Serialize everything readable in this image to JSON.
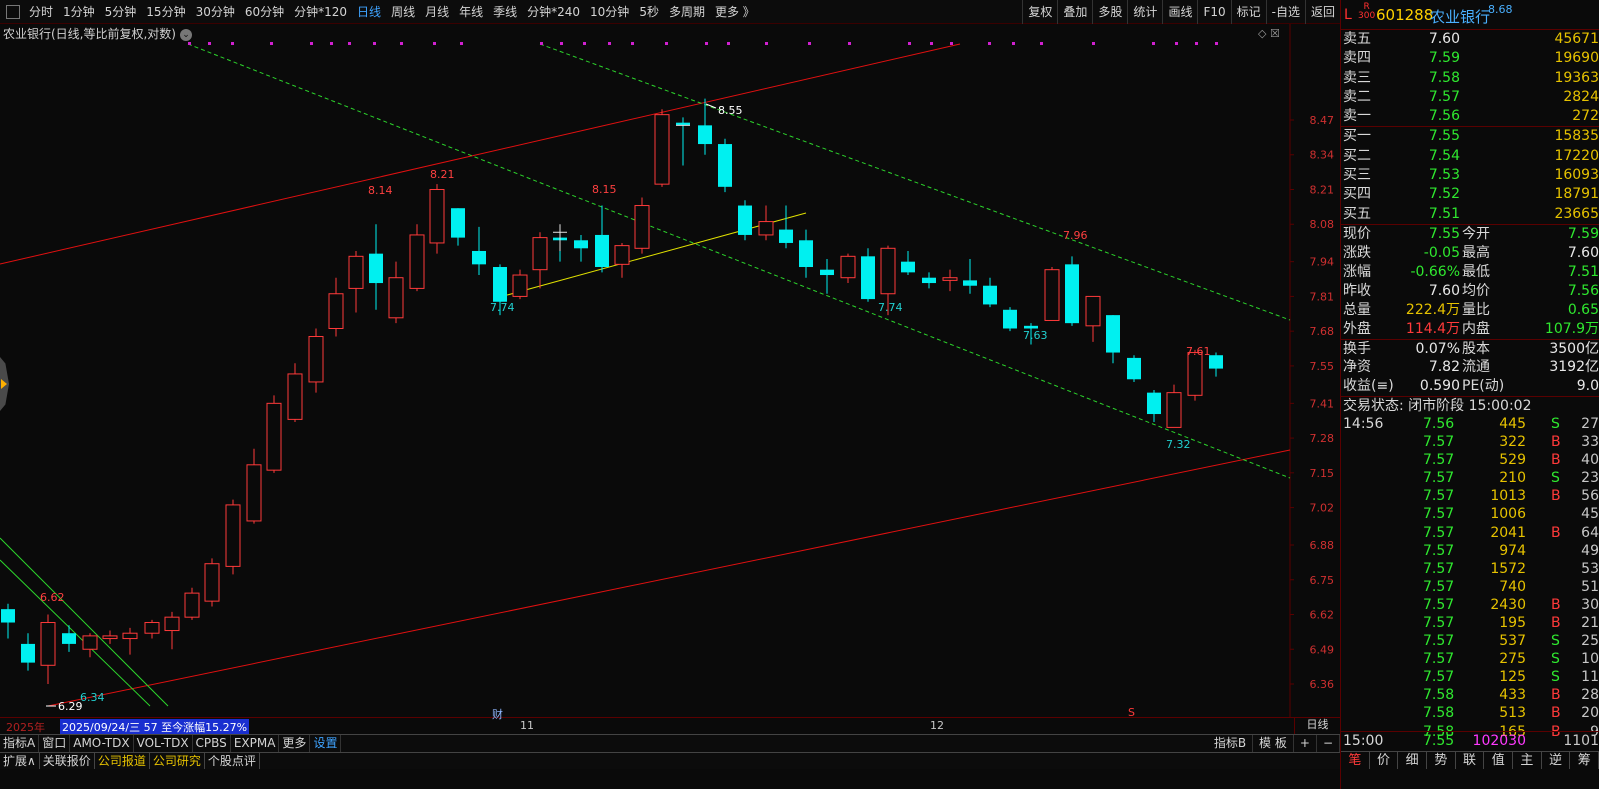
{
  "toolbar": {
    "periods": [
      "分时",
      "1分钟",
      "5分钟",
      "15分钟",
      "30分钟",
      "60分钟",
      "分钟*120",
      "日线",
      "周线",
      "月线",
      "年线",
      "季线",
      "分钟*240",
      "10分钟",
      "5秒",
      "多周期",
      "更多 》"
    ],
    "active_period": "日线",
    "right_buttons": [
      "复权",
      "叠加",
      "多股",
      "统计",
      "画线",
      "F10",
      "标记",
      "-自选",
      "返回"
    ]
  },
  "chart": {
    "title": "农业银行(日线,等比前复权,对数)",
    "icons": "◇ ☒",
    "price_axis": [
      "8.47",
      "8.34",
      "8.21",
      "8.08",
      "7.94",
      "7.81",
      "7.68",
      "7.55",
      "7.41",
      "7.28",
      "7.15",
      "7.02",
      "6.88",
      "6.75",
      "6.62",
      "6.49",
      "6.36"
    ],
    "annotations": [
      "6.62",
      "6.34",
      "6.29",
      "8.14",
      "8.21",
      "7.74",
      "8.15",
      "8.55",
      "7.74",
      "7.96",
      "7.63",
      "7.61",
      "7.32"
    ],
    "date_year": "2025年",
    "date_range": "2025/09/24/三  57  至今涨幅15.27%",
    "date_nov": "11",
    "date_dec": "12",
    "marker_cai": "财",
    "marker_s": "S",
    "period_label": "日线"
  },
  "indicators": {
    "left": [
      "指标A",
      "窗口",
      "AMO-TDX",
      "VOL-TDX",
      "CPBS",
      "EXPMA",
      "更多",
      "设置"
    ],
    "right": [
      "指标B",
      "模 板",
      "+",
      "−"
    ]
  },
  "bottom_tabs": [
    "扩展∧",
    "关联报价",
    "公司报道",
    "公司研究",
    "个股点评"
  ],
  "quote": {
    "flag_L": "L",
    "flag_R": "R",
    "flag_300": "300",
    "code": "601288",
    "name": "农业银行",
    "dist": "8.68",
    "asks": [
      {
        "label": "卖五",
        "price": "7.60",
        "vol": "45671"
      },
      {
        "label": "卖四",
        "price": "7.59",
        "vol": "19690"
      },
      {
        "label": "卖三",
        "price": "7.58",
        "vol": "19363"
      },
      {
        "label": "卖二",
        "price": "7.57",
        "vol": "2824"
      },
      {
        "label": "卖一",
        "price": "7.56",
        "vol": "272"
      }
    ],
    "bids": [
      {
        "label": "买一",
        "price": "7.55",
        "vol": "15835"
      },
      {
        "label": "买二",
        "price": "7.54",
        "vol": "17220"
      },
      {
        "label": "买三",
        "price": "7.53",
        "vol": "16093"
      },
      {
        "label": "买四",
        "price": "7.52",
        "vol": "18791"
      },
      {
        "label": "买五",
        "price": "7.51",
        "vol": "23665"
      }
    ],
    "stats": [
      {
        "l1": "现价",
        "v1": "7.55",
        "l2": "今开",
        "v2": "7.59"
      },
      {
        "l1": "涨跌",
        "v1": "-0.05",
        "l2": "最高",
        "v2": "7.60"
      },
      {
        "l1": "涨幅",
        "v1": "-0.66%",
        "l2": "最低",
        "v2": "7.51"
      },
      {
        "l1": "昨收",
        "v1": "7.60",
        "l2": "均价",
        "v2": "7.56"
      },
      {
        "l1": "总量",
        "v1": "222.4万",
        "l2": "量比",
        "v2": "0.65"
      },
      {
        "l1": "外盘",
        "v1": "114.4万",
        "l2": "内盘",
        "v2": "107.9万"
      },
      {
        "l1": "换手",
        "v1": "0.07%",
        "l2": "股本",
        "v2": "3500亿"
      },
      {
        "l1": "净资",
        "v1": "7.82",
        "l2": "流通",
        "v2": "3192亿"
      },
      {
        "l1": "收益(≡)",
        "v1": "0.590",
        "l2": "PE(动)",
        "v2": "9.0"
      }
    ],
    "trade_status": "交易状态: 闭市阶段 15:00:02",
    "ticks": [
      {
        "time": "14:56",
        "price": "7.56",
        "vol": "445",
        "bs": "S",
        "cnt": "27"
      },
      {
        "time": "",
        "price": "7.57",
        "vol": "322",
        "bs": "B",
        "cnt": "33"
      },
      {
        "time": "",
        "price": "7.57",
        "vol": "529",
        "bs": "B",
        "cnt": "40"
      },
      {
        "time": "",
        "price": "7.57",
        "vol": "210",
        "bs": "S",
        "cnt": "23"
      },
      {
        "time": "",
        "price": "7.57",
        "vol": "1013",
        "bs": "B",
        "cnt": "56"
      },
      {
        "time": "",
        "price": "7.57",
        "vol": "1006",
        "bs": "",
        "cnt": "45"
      },
      {
        "time": "",
        "price": "7.57",
        "vol": "2041",
        "bs": "B",
        "cnt": "64"
      },
      {
        "time": "",
        "price": "7.57",
        "vol": "974",
        "bs": "",
        "cnt": "49"
      },
      {
        "time": "",
        "price": "7.57",
        "vol": "1572",
        "bs": "",
        "cnt": "53"
      },
      {
        "time": "",
        "price": "7.57",
        "vol": "740",
        "bs": "",
        "cnt": "51"
      },
      {
        "time": "",
        "price": "7.57",
        "vol": "2430",
        "bs": "B",
        "cnt": "30"
      },
      {
        "time": "",
        "price": "7.57",
        "vol": "195",
        "bs": "B",
        "cnt": "21"
      },
      {
        "time": "",
        "price": "7.57",
        "vol": "537",
        "bs": "S",
        "cnt": "25"
      },
      {
        "time": "",
        "price": "7.57",
        "vol": "275",
        "bs": "S",
        "cnt": "10"
      },
      {
        "time": "",
        "price": "7.57",
        "vol": "125",
        "bs": "S",
        "cnt": "11"
      },
      {
        "time": "",
        "price": "7.58",
        "vol": "433",
        "bs": "B",
        "cnt": "28"
      },
      {
        "time": "",
        "price": "7.58",
        "vol": "513",
        "bs": "B",
        "cnt": "20"
      },
      {
        "time": "",
        "price": "7.58",
        "vol": "165",
        "bs": "B",
        "cnt": "9"
      }
    ],
    "footer": {
      "time": "15:00",
      "price": "7.55",
      "vol": "102030",
      "cnt": "1101"
    },
    "tabs": [
      "笔",
      "价",
      "细",
      "势",
      "联",
      "值",
      "主",
      "逆",
      "筹"
    ]
  },
  "colors": {
    "up": "#ff3a3a",
    "down": "#00f0f0",
    "channel": "#e01010",
    "dashed": "#2cd42c",
    "support": "#e0e000"
  }
}
